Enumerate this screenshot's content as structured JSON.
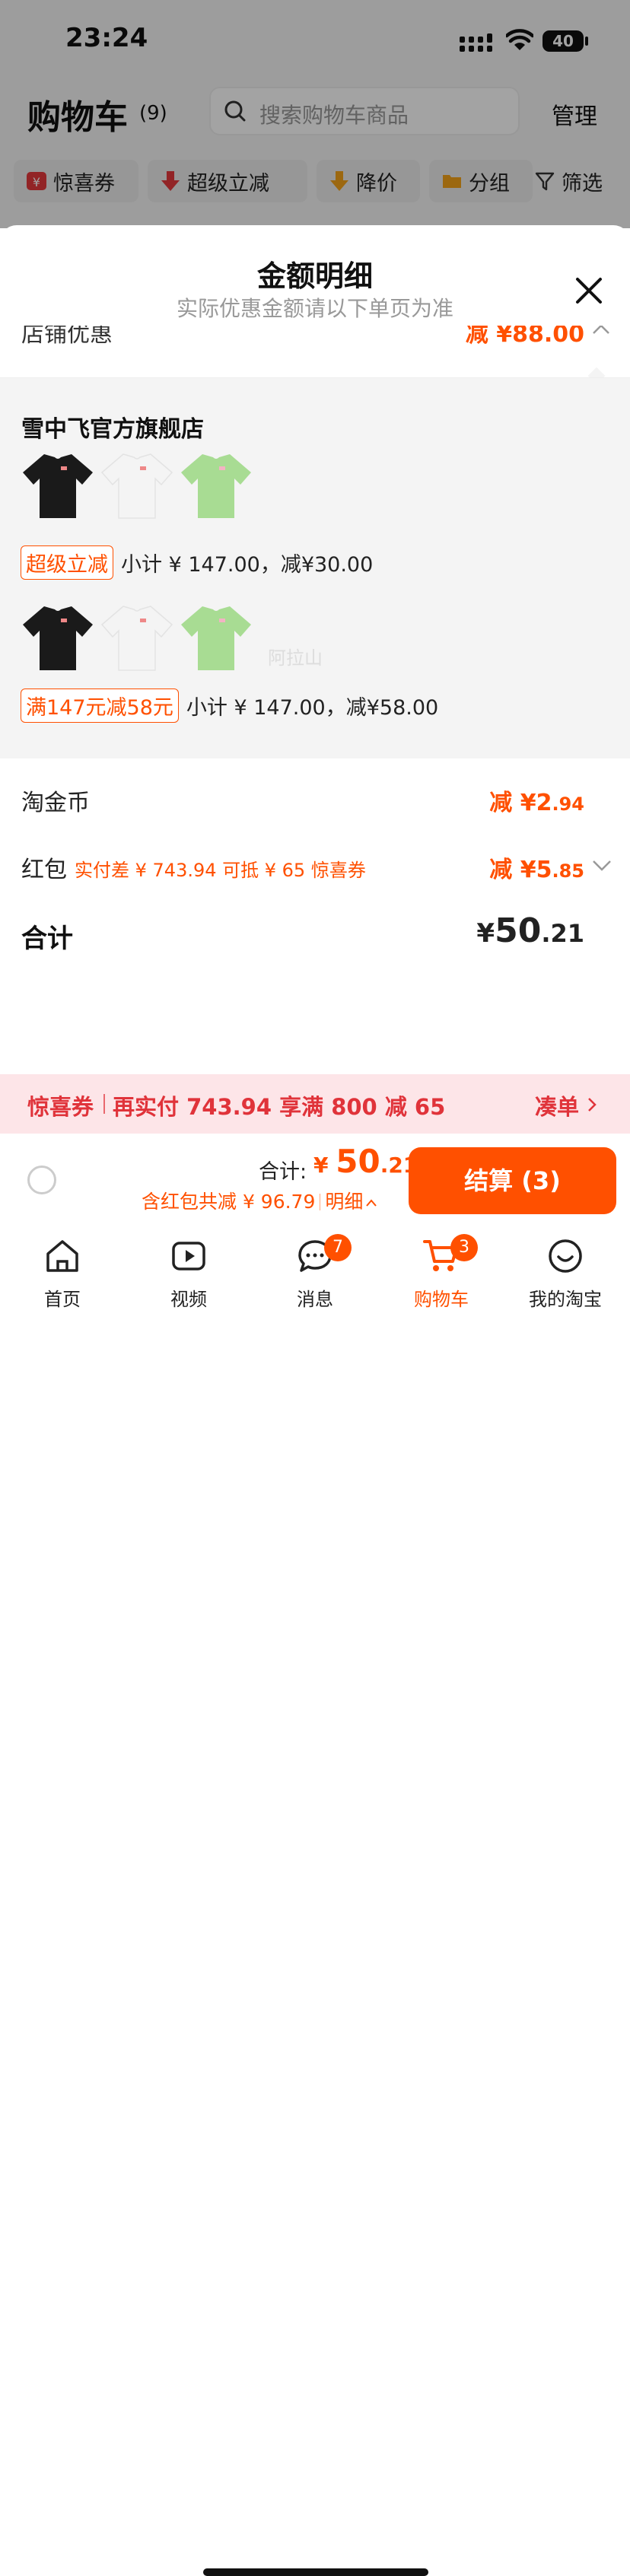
{
  "status_bar": {
    "time": "23:24",
    "battery": "40"
  },
  "cart_header": {
    "title": "购物车",
    "count": "(9)",
    "search_placeholder": "搜索购物车商品",
    "manage": "管理"
  },
  "filter_chips": [
    {
      "label": "惊喜券",
      "icon": "coupon-icon"
    },
    {
      "label": "超级立减",
      "icon": "arrow-down-icon"
    },
    {
      "label": "降价",
      "icon": "price-drop-icon"
    },
    {
      "label": "分组",
      "icon": "folder-icon"
    },
    {
      "label": "筛选",
      "icon": "filter-icon"
    }
  ],
  "sheet": {
    "title": "金额明细",
    "subtitle": "实际优惠金额请以下单页为准",
    "store_discount": {
      "label": "店铺优惠",
      "value": "减 ¥88.00"
    },
    "shop_name": "雪中飞官方旗舰店",
    "groups": [
      {
        "tag": "超级立减",
        "subtotal": "小计 ¥ 147.00，减¥30.00",
        "items": [
          {
            "color": "black"
          },
          {
            "color": "white"
          },
          {
            "color": "green"
          }
        ]
      },
      {
        "tag": "满147元减58元",
        "subtotal": "小计 ¥ 147.00，减¥58.00",
        "items": [
          {
            "color": "black"
          },
          {
            "color": "white"
          },
          {
            "color": "green"
          }
        ]
      }
    ],
    "watermark": "阿拉山",
    "tao_coin": {
      "label": "淘金币",
      "prefix": "减 ¥",
      "int": "2",
      "dec": ".94"
    },
    "red_packet": {
      "label": "红包",
      "hint": "实付差 ¥ 743.94 可抵 ¥ 65 惊喜券",
      "prefix": "减 ¥",
      "int": "5",
      "dec": ".85"
    },
    "total": {
      "label": "合计",
      "cur": "¥",
      "int": "50",
      "dec": ".21"
    }
  },
  "banner": {
    "title": "惊喜券",
    "text": "再实付 743.94 享满 800 减 65",
    "action": "凑单"
  },
  "checkout": {
    "sum_label": "合计:",
    "sum_cur": "¥ ",
    "sum_int": "50",
    "sum_dec": ".21",
    "discount_text": "含红包共减 ¥ 96.79",
    "detail": "明细",
    "pay_button": "结算 (3)"
  },
  "tabbar": [
    {
      "label": "首页",
      "icon": "home-icon"
    },
    {
      "label": "视频",
      "icon": "video-icon"
    },
    {
      "label": "消息",
      "icon": "message-icon",
      "badge": "7"
    },
    {
      "label": "购物车",
      "icon": "cart-icon",
      "badge": "3",
      "active": true
    },
    {
      "label": "我的淘宝",
      "icon": "profile-icon"
    }
  ],
  "colors": {
    "accent": "#ff5000",
    "banner_bg": "#fde5e8",
    "banner_text": "#e0333a"
  }
}
